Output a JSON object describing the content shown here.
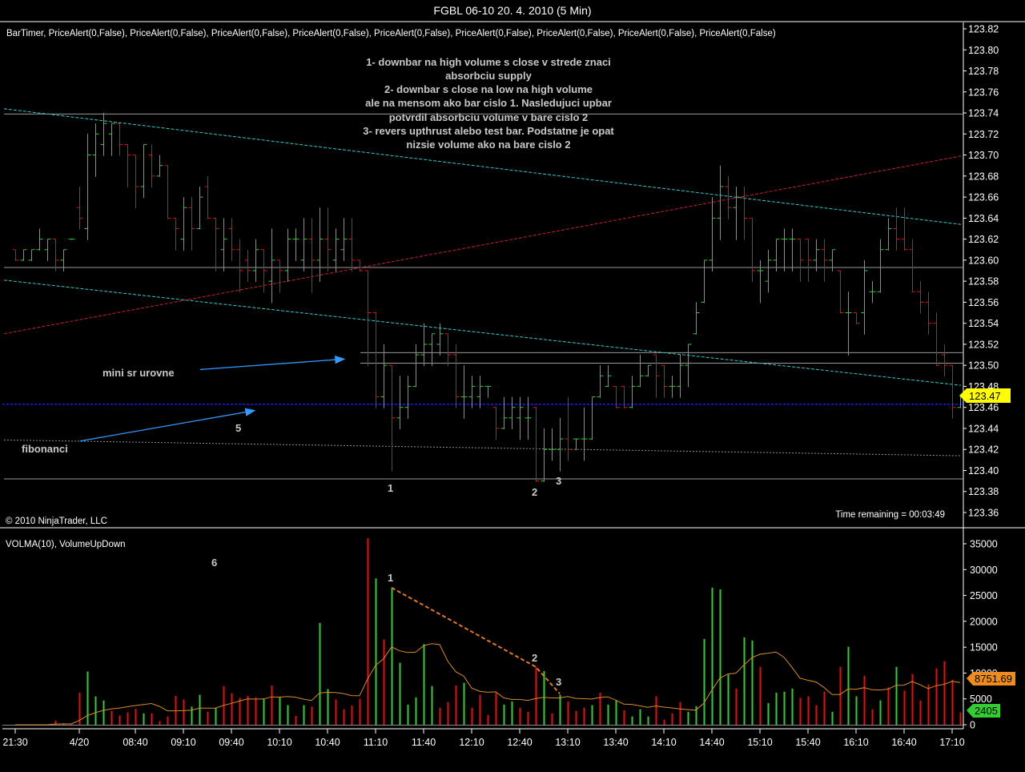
{
  "window": {
    "title": "FGBL 06-10  20. 4. 2010 (5 Min)",
    "indicators_label": "BarTimer, PriceAlert(0,False), PriceAlert(0,False),  PriceAlert(0,False), PriceAlert(0,False), PriceAlert(0,False), PriceAlert(0,False),  PriceAlert(0,False), PriceAlert(0,False), PriceAlert(0,False)",
    "copyright": "© 2010 NinjaTrader, LLC",
    "time_remaining": "Time remaining = 00:03:49",
    "volume_panel_label": "VOLMA(10), VolumeUpDown"
  },
  "annotations": {
    "explanation_lines": [
      "1- downbar na high volume s close v strede znaci",
      "absorbciu supply",
      "2- downbar s close na low na high volume",
      "ale na mensom ako bar cislo 1. Nasledujuci upbar",
      "potvrdil absorbciu volume v bare cislo 2",
      "3- revers upthrust alebo test bar. Podstatne je opat",
      "nizsie volume ako na bare cislo 2"
    ],
    "mini_sr": "mini sr urovne",
    "fibonanci": "fibonanci",
    "mark_5": "5",
    "mark_6": "6",
    "price_marks": [
      "1",
      "2",
      "3"
    ],
    "volume_marks": [
      "1",
      "2",
      "3"
    ]
  },
  "chart_data": {
    "type": "ohlc+volume",
    "title": "FGBL 06-10  20. 4. 2010 (5 Min)",
    "colors": {
      "up": "#33cc33",
      "down": "#e41010",
      "volma": "#d98a2b",
      "channel": "#33cccc",
      "trend": "#c8203a",
      "level": "#9a9a9a",
      "blue_level": "#1a1aff",
      "fib": "#8a9a8a",
      "arrow": "#3399ff",
      "price_tag": "#ffff00",
      "volma_tag": "#f08c1e",
      "volume_tag": "#33cc33"
    },
    "price_panel": {
      "ylim": [
        123.36,
        123.82
      ],
      "y_ticks": [
        "123.82",
        "123.80",
        "123.78",
        "123.76",
        "123.74",
        "123.72",
        "123.70",
        "123.68",
        "123.66",
        "123.64",
        "123.62",
        "123.60",
        "123.58",
        "123.56",
        "123.54",
        "123.52",
        "123.50",
        "123.48",
        "123.46",
        "123.44",
        "123.42",
        "123.40",
        "123.38",
        "123.36"
      ],
      "last_price": "123.47",
      "bars_ohlc": [
        [
          123.61,
          123.61,
          123.6,
          123.6
        ],
        [
          123.6,
          123.61,
          123.6,
          123.61
        ],
        [
          123.6,
          123.61,
          123.6,
          123.61
        ],
        [
          123.61,
          123.63,
          123.61,
          123.62
        ],
        [
          123.61,
          123.62,
          123.6,
          123.62
        ],
        [
          123.62,
          123.62,
          123.59,
          123.6
        ],
        [
          123.6,
          123.61,
          123.59,
          123.61
        ],
        [
          123.62,
          123.62,
          123.62,
          123.62
        ],
        [
          123.65,
          123.67,
          123.63,
          123.64
        ],
        [
          123.63,
          123.72,
          123.62,
          123.7
        ],
        [
          123.7,
          123.73,
          123.68,
          123.72
        ],
        [
          123.71,
          123.74,
          123.7,
          123.73
        ],
        [
          123.72,
          123.73,
          123.7,
          123.73
        ],
        [
          123.73,
          123.73,
          123.7,
          123.71
        ],
        [
          123.71,
          123.71,
          123.67,
          123.7
        ],
        [
          123.7,
          123.7,
          123.65,
          123.67
        ],
        [
          123.67,
          123.71,
          123.66,
          123.71
        ],
        [
          123.7,
          123.71,
          123.67,
          123.68
        ],
        [
          123.68,
          123.7,
          123.68,
          123.69
        ],
        [
          123.69,
          123.69,
          123.64,
          123.64
        ],
        [
          123.64,
          123.64,
          123.61,
          123.63
        ],
        [
          123.62,
          123.66,
          123.61,
          123.65
        ],
        [
          123.65,
          123.66,
          123.61,
          123.63
        ],
        [
          123.63,
          123.67,
          123.63,
          123.66
        ],
        [
          123.67,
          123.68,
          123.64,
          123.64
        ],
        [
          123.64,
          123.64,
          123.59,
          123.63
        ],
        [
          123.61,
          123.64,
          123.59,
          123.62
        ],
        [
          123.63,
          123.64,
          123.6,
          123.61
        ],
        [
          123.61,
          123.62,
          123.57,
          123.59
        ],
        [
          123.6,
          123.61,
          123.58,
          123.59
        ],
        [
          123.59,
          123.62,
          123.58,
          123.61
        ],
        [
          123.61,
          123.61,
          123.57,
          123.59
        ],
        [
          123.58,
          123.63,
          123.56,
          123.6
        ],
        [
          123.6,
          123.6,
          123.57,
          123.59
        ],
        [
          123.59,
          123.63,
          123.58,
          123.62
        ],
        [
          123.62,
          123.63,
          123.6,
          123.62
        ],
        [
          123.6,
          123.64,
          123.59,
          123.62
        ],
        [
          123.62,
          123.64,
          123.57,
          123.6
        ],
        [
          123.6,
          123.65,
          123.58,
          123.62
        ],
        [
          123.62,
          123.65,
          123.59,
          123.61
        ],
        [
          123.6,
          123.63,
          123.59,
          123.62
        ],
        [
          123.61,
          123.64,
          123.6,
          123.62
        ],
        [
          123.62,
          123.64,
          123.59,
          123.6
        ],
        [
          123.6,
          123.6,
          123.59,
          123.59
        ],
        [
          123.59,
          123.59,
          123.5,
          123.55
        ],
        [
          123.55,
          123.55,
          123.46,
          123.47
        ],
        [
          123.47,
          123.52,
          123.46,
          123.5
        ],
        [
          123.5,
          123.5,
          123.4,
          123.45
        ],
        [
          123.45,
          123.49,
          123.44,
          123.46
        ],
        [
          123.46,
          123.49,
          123.45,
          123.48
        ],
        [
          123.48,
          123.52,
          123.48,
          123.51
        ],
        [
          123.51,
          123.54,
          123.5,
          123.52
        ],
        [
          123.52,
          123.53,
          123.5,
          123.53
        ],
        [
          123.52,
          123.54,
          123.51,
          123.53
        ],
        [
          123.53,
          123.53,
          123.5,
          123.51
        ],
        [
          123.51,
          123.52,
          123.46,
          123.47
        ],
        [
          123.47,
          123.5,
          123.45,
          123.47
        ],
        [
          123.47,
          123.49,
          123.46,
          123.48
        ],
        [
          123.47,
          123.49,
          123.46,
          123.48
        ],
        [
          123.48,
          123.48,
          123.47,
          123.48
        ],
        [
          123.46,
          123.46,
          123.43,
          123.44
        ],
        [
          123.44,
          123.47,
          123.44,
          123.45
        ],
        [
          123.45,
          123.47,
          123.44,
          123.46
        ],
        [
          123.45,
          123.47,
          123.43,
          123.46
        ],
        [
          123.45,
          123.47,
          123.43,
          123.45
        ],
        [
          123.46,
          123.46,
          123.39,
          123.39
        ],
        [
          123.39,
          123.44,
          123.39,
          123.42
        ],
        [
          123.42,
          123.44,
          123.41,
          123.42
        ],
        [
          123.42,
          123.45,
          123.4,
          123.43
        ],
        [
          123.43,
          123.47,
          123.41,
          123.42
        ],
        [
          123.43,
          123.43,
          123.42,
          123.43
        ],
        [
          123.43,
          123.46,
          123.41,
          123.43
        ],
        [
          123.43,
          123.47,
          123.43,
          123.47
        ],
        [
          123.47,
          123.5,
          123.47,
          123.49
        ],
        [
          123.48,
          123.5,
          123.48,
          123.49
        ],
        [
          123.48,
          123.48,
          123.46,
          123.46
        ],
        [
          123.48,
          123.48,
          123.46,
          123.46
        ],
        [
          123.46,
          123.49,
          123.46,
          123.48
        ],
        [
          123.48,
          123.51,
          123.48,
          123.49
        ],
        [
          123.49,
          123.5,
          123.49,
          123.5
        ],
        [
          123.51,
          123.51,
          123.47,
          123.49
        ],
        [
          123.5,
          123.5,
          123.47,
          123.48
        ],
        [
          123.48,
          123.49,
          123.47,
          123.48
        ],
        [
          123.48,
          123.51,
          123.47,
          123.5
        ],
        [
          123.5,
          123.52,
          123.48,
          123.52
        ],
        [
          123.53,
          123.56,
          123.53,
          123.55
        ],
        [
          123.56,
          123.6,
          123.56,
          123.6
        ],
        [
          123.6,
          123.66,
          123.59,
          123.64
        ],
        [
          123.64,
          123.69,
          123.62,
          123.67
        ],
        [
          123.67,
          123.68,
          123.64,
          123.65
        ],
        [
          123.65,
          123.67,
          123.62,
          123.66
        ],
        [
          123.66,
          123.67,
          123.62,
          123.64
        ],
        [
          123.64,
          123.64,
          123.58,
          123.59
        ],
        [
          123.59,
          123.6,
          123.56,
          123.59
        ],
        [
          123.58,
          123.61,
          123.57,
          123.6
        ],
        [
          123.6,
          123.62,
          123.59,
          123.62
        ],
        [
          123.62,
          123.63,
          123.59,
          123.62
        ],
        [
          123.62,
          123.63,
          123.59,
          123.62
        ],
        [
          123.62,
          123.62,
          123.58,
          123.6
        ],
        [
          123.62,
          123.62,
          123.58,
          123.6
        ],
        [
          123.6,
          123.62,
          123.59,
          123.61
        ],
        [
          123.61,
          123.62,
          123.58,
          123.6
        ],
        [
          123.6,
          123.61,
          123.59,
          123.61
        ],
        [
          123.59,
          123.59,
          123.55,
          123.55
        ],
        [
          123.55,
          123.57,
          123.51,
          123.55
        ],
        [
          123.55,
          123.55,
          123.54,
          123.54
        ],
        [
          123.55,
          123.6,
          123.53,
          123.59
        ],
        [
          123.57,
          123.58,
          123.56,
          123.57
        ],
        [
          123.57,
          123.62,
          123.57,
          123.61
        ],
        [
          123.61,
          123.64,
          123.61,
          123.63
        ],
        [
          123.63,
          123.65,
          123.61,
          123.62
        ],
        [
          123.62,
          123.65,
          123.61,
          123.61
        ],
        [
          123.61,
          123.62,
          123.57,
          123.57
        ],
        [
          123.57,
          123.58,
          123.55,
          123.56
        ],
        [
          123.56,
          123.57,
          123.53,
          123.54
        ],
        [
          123.54,
          123.55,
          123.5,
          123.5
        ],
        [
          123.51,
          123.52,
          123.49,
          123.5
        ],
        [
          123.5,
          123.5,
          123.45,
          123.46
        ],
        [
          123.46,
          123.47,
          123.46,
          123.47
        ]
      ],
      "drawings": {
        "channel_upper": [
          [
            -1.4,
            123.744
          ],
          [
            118.1,
            123.634
          ]
        ],
        "channel_lower": [
          [
            -1.4,
            123.581
          ],
          [
            118.1,
            123.481
          ]
        ],
        "trend_red": [
          [
            -1.4,
            123.53
          ],
          [
            118.1,
            123.699
          ]
        ],
        "levels": [
          [
            -1.4,
            123.739
          ],
          [
            -1.4,
            123.593
          ],
          [
            43.1,
            123.512
          ],
          [
            43.1,
            123.502
          ],
          [
            -1.4,
            123.392
          ]
        ],
        "blue_level": 123.463,
        "fib_line": [
          [
            -1.4,
            123.429
          ],
          [
            118.1,
            123.414
          ]
        ],
        "arrows": [
          [
            [
              23.1,
              123.496
            ],
            [
              41.1,
              123.506
            ]
          ],
          [
            [
              8.1,
              123.428
            ],
            [
              29.9,
              123.457
            ]
          ]
        ]
      }
    },
    "volume_panel": {
      "ylim": [
        0,
        35000
      ],
      "y_ticks": [
        "35000",
        "30000",
        "25000",
        "20000",
        "15000",
        "10000",
        "5000",
        "0"
      ],
      "volma_period": 10,
      "volma_last": "8751.69",
      "last_volume": "2405",
      "volume": [
        0,
        0,
        0,
        0,
        0,
        800,
        300,
        100,
        6200,
        10300,
        5500,
        4700,
        2700,
        1800,
        2400,
        3100,
        2200,
        2200,
        700,
        1600,
        5600,
        4900,
        3500,
        5800,
        2500,
        3200,
        7500,
        6100,
        5200,
        5600,
        5300,
        5100,
        7600,
        5300,
        3800,
        1700,
        3800,
        3500,
        19700,
        6900,
        4900,
        3000,
        3700,
        5000,
        36100,
        28300,
        16500,
        26500,
        12000,
        3900,
        5300,
        15600,
        7500,
        3300,
        4400,
        7600,
        8100,
        3300,
        5800,
        1900,
        6200,
        3900,
        4500,
        3300,
        2500,
        11200,
        10400,
        2200,
        5800,
        4500,
        2700,
        3300,
        3800,
        6200,
        3900,
        4700,
        2800,
        1600,
        3000,
        1600,
        5500,
        1000,
        2200,
        4400,
        2500,
        3600,
        16600,
        26500,
        26200,
        9700,
        7000,
        16900,
        16300,
        11200,
        4200,
        6200,
        6400,
        7000,
        5200,
        5500,
        3800,
        6400,
        2500,
        11200,
        15100,
        5500,
        9500,
        3000,
        4700,
        7200,
        11200,
        6600,
        9800,
        4700,
        7800,
        10900,
        12300,
        8700,
        2405
      ],
      "volume_dir": "ddddddddduuudddduddddduududdddduduududuuddddduduuuuuudddudddduudddududdduduuduuudddduuuuuuduuduuuudddduduuddududdddddddddu",
      "annotation_line": [
        [
          47,
          26500
        ],
        [
          65,
          11200
        ],
        [
          68,
          6000
        ]
      ]
    },
    "x_ticks": [
      {
        "label": "21:30",
        "bar": 0
      },
      {
        "label": "4/20",
        "bar": 8
      },
      {
        "label": "08:40",
        "bar": 15
      },
      {
        "label": "09:10",
        "bar": 21
      },
      {
        "label": "09:40",
        "bar": 27
      },
      {
        "label": "10:10",
        "bar": 33
      },
      {
        "label": "10:40",
        "bar": 39
      },
      {
        "label": "11:10",
        "bar": 45
      },
      {
        "label": "11:40",
        "bar": 51
      },
      {
        "label": "12:10",
        "bar": 57
      },
      {
        "label": "12:40",
        "bar": 63
      },
      {
        "label": "13:10",
        "bar": 69
      },
      {
        "label": "13:40",
        "bar": 75
      },
      {
        "label": "14:10",
        "bar": 81
      },
      {
        "label": "14:40",
        "bar": 87
      },
      {
        "label": "15:10",
        "bar": 93
      },
      {
        "label": "15:40",
        "bar": 99
      },
      {
        "label": "16:10",
        "bar": 105
      },
      {
        "label": "16:40",
        "bar": 111
      },
      {
        "label": "17:10",
        "bar": 117
      }
    ]
  }
}
